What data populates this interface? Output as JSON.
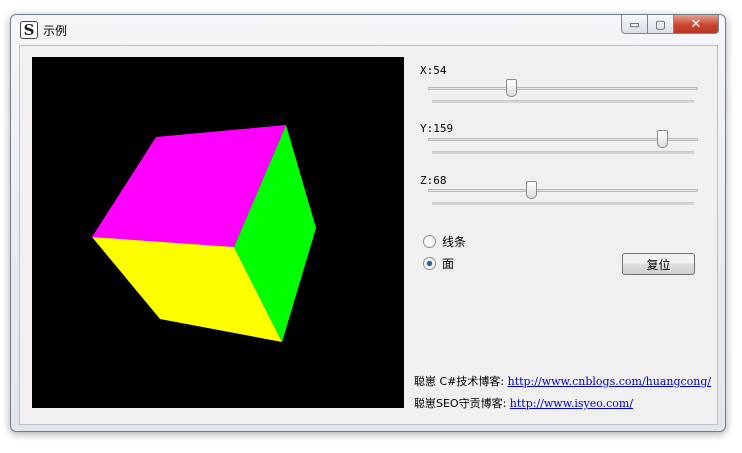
{
  "window": {
    "title": "示例",
    "app_icon_glyph": "S",
    "controls": {
      "minimize": "▭",
      "maximize": "▢",
      "close": "✕"
    }
  },
  "sliders": [
    {
      "label": "X:54",
      "value": 54,
      "min": 0,
      "max": 180
    },
    {
      "label": "Y:159",
      "value": 159,
      "min": 0,
      "max": 180
    },
    {
      "label": "Z:68",
      "value": 68,
      "min": 0,
      "max": 180
    }
  ],
  "render_mode": {
    "options": [
      {
        "label": "线条",
        "checked": false
      },
      {
        "label": "面",
        "checked": true
      }
    ]
  },
  "reset_label": "复位",
  "links": [
    {
      "label": "聪崽 C#技术博客:",
      "url_text": "http://www.cnblogs.com/huangcong/"
    },
    {
      "label": "聪崽SEO守贡博客:",
      "url_text": "http://www.isyeo.com/"
    }
  ],
  "colors": {
    "canvas_bg": "#000000",
    "face_top": "#ff00ff",
    "face_left": "#ffff00",
    "face_right": "#00ff00",
    "link": "#0000cc"
  }
}
